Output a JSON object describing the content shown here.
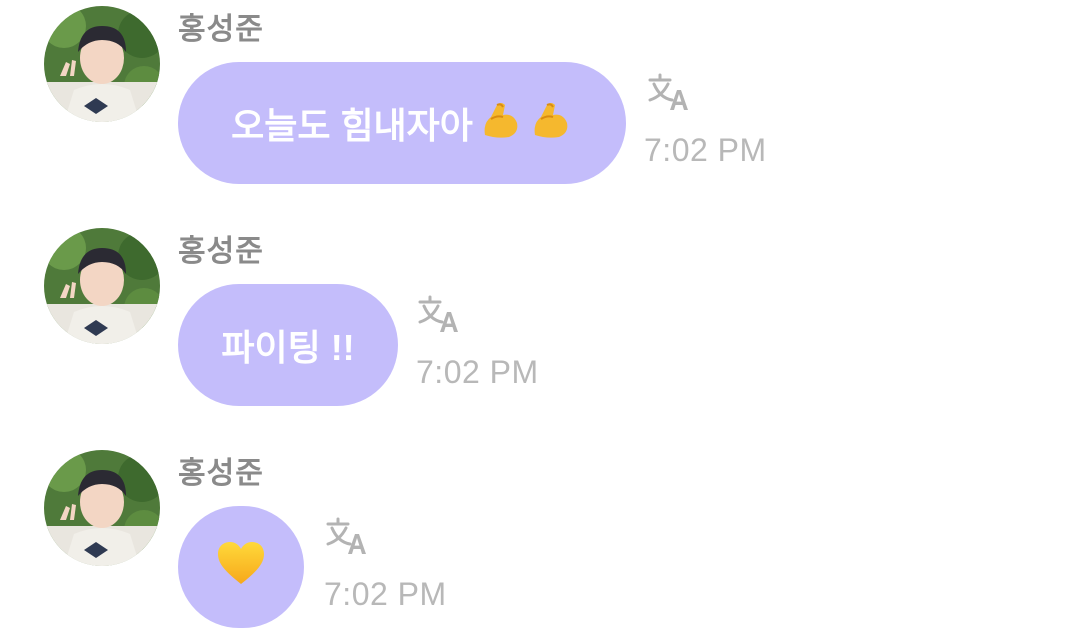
{
  "messages": [
    {
      "sender": "홍성준",
      "text": "오늘도 힘내자아",
      "emoji": [
        "flexed-biceps",
        "flexed-biceps"
      ],
      "time": "7:02 PM"
    },
    {
      "sender": "홍성준",
      "text": "파이팅 !!",
      "emoji": [],
      "time": "7:02 PM"
    },
    {
      "sender": "홍성준",
      "text": "",
      "emoji": [
        "yellow-heart"
      ],
      "time": "7:02 PM"
    }
  ],
  "icons": {
    "translate": "translate-icon",
    "avatar": "profile-photo"
  },
  "colors": {
    "bubble": "#c4bdfb",
    "bubble_text": "#ffffff",
    "sender": "#8a8a8a",
    "time": "#b8b8b8",
    "icon": "#b3b3b3",
    "background": "#ffffff"
  }
}
